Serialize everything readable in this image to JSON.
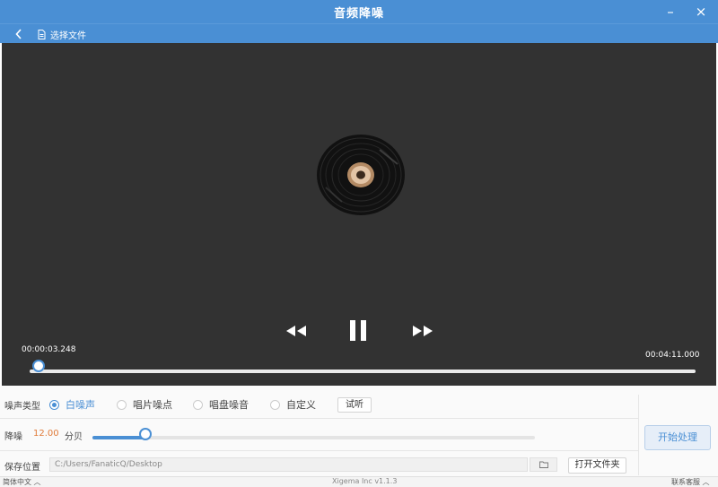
{
  "window": {
    "title": "音频降噪",
    "minimize_glyph": "–",
    "close_glyph": "×"
  },
  "toolbar": {
    "back_icon": "chevron-left-icon",
    "select_file_label": "选择文件"
  },
  "player": {
    "current_time": "00:00:03.248",
    "total_time": "00:04:11.000",
    "progress_fraction": 0.013,
    "state": "playing"
  },
  "noise_type": {
    "label": "噪声类型",
    "options": [
      "白噪声",
      "唱片噪点",
      "唱盘噪音",
      "自定义"
    ],
    "selected_index": 0,
    "preview_button": "试听"
  },
  "noise_reduction": {
    "label": "降噪",
    "value": "12.00",
    "unit": "分贝",
    "level_fraction": 0.12
  },
  "save": {
    "label": "保存位置",
    "path": "C:/Users/FanaticQ/Desktop",
    "open_folder_button": "打开文件夹"
  },
  "start_button": "开始处理",
  "statusbar": {
    "language": "简体中文",
    "version": "Xigema Inc v1.1.3",
    "contact": "联系客服"
  },
  "colors": {
    "accent": "#4a8fd4",
    "player_bg": "#323232"
  }
}
